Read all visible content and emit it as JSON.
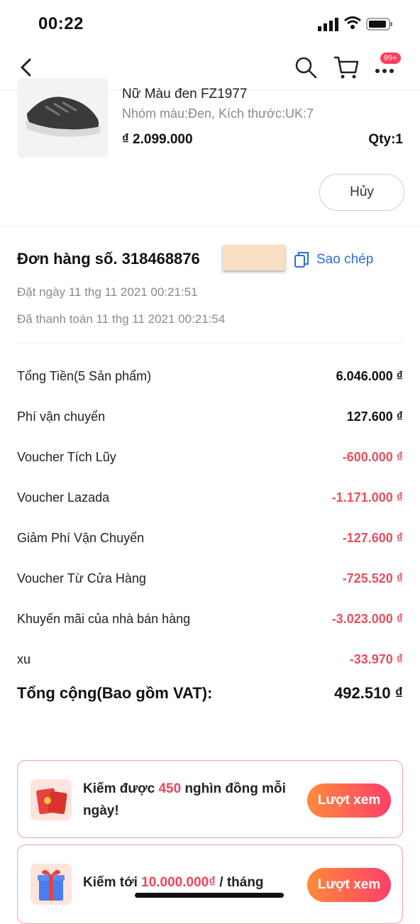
{
  "status": {
    "time": "00:22"
  },
  "nav": {
    "badge": "99+"
  },
  "product": {
    "name": "Nữ Màu đen FZ1977",
    "variant": "Nhóm màu:Đen, Kích thước:UK:7",
    "price": "₫ 2.099.000",
    "qty": "Qty:1",
    "cancel_label": "Hủy"
  },
  "order": {
    "title": "Đơn hàng số. 31846887​6",
    "copy_label": "Sao chép",
    "placed": "Đặt ngày 11 thg 11 2021  00:21:51",
    "paid": "Đã thanh toán 11 thg 11 2021  00:21:54"
  },
  "summary": [
    {
      "label": "Tổng Tiền(5 Sản phẩm)",
      "value": "6.046.000 ₫",
      "negative": false
    },
    {
      "label": "Phí vận chuyển",
      "value": "127.600 ₫",
      "negative": false
    },
    {
      "label": "Voucher Tích Lũy",
      "value": "-600.000 ₫",
      "negative": true
    },
    {
      "label": "Voucher Lazada",
      "value": "-1.171.000 ₫",
      "negative": true
    },
    {
      "label": "Giảm Phí Vận Chuyển",
      "value": "-127.600 ₫",
      "negative": true
    },
    {
      "label": "Voucher Từ Cửa Hàng",
      "value": "-725.520 ₫",
      "negative": true
    },
    {
      "label": "Khuyến mãi của nhà bán hàng",
      "value": "-3.023.000 ₫",
      "negative": true
    },
    {
      "label": "xu",
      "value": "-33.970 ₫",
      "negative": true
    }
  ],
  "total": {
    "label": "Tổng cộng(Bao gồm VAT):",
    "value": "492.510 ₫"
  },
  "promos": {
    "card1": {
      "pre": "Kiếm được ",
      "highlight": "450",
      "post": " nghìn đồng mỗi ngày!",
      "button": "Lượt xem"
    },
    "card2": {
      "pre": "Kiếm tới ",
      "highlight": "10.000.000₫",
      "post": " / tháng",
      "button": "Lượt xem"
    }
  },
  "colors": {
    "accent_red": "#e84f5e",
    "link_blue": "#2a6dd8",
    "button_gradient_start": "#ff8a3a",
    "button_gradient_end": "#ff3f6a"
  },
  "icons": [
    "back-arrow-icon",
    "search-icon",
    "cart-icon",
    "more-icon",
    "copy-icon",
    "red-envelope-icon",
    "gift-box-icon"
  ]
}
